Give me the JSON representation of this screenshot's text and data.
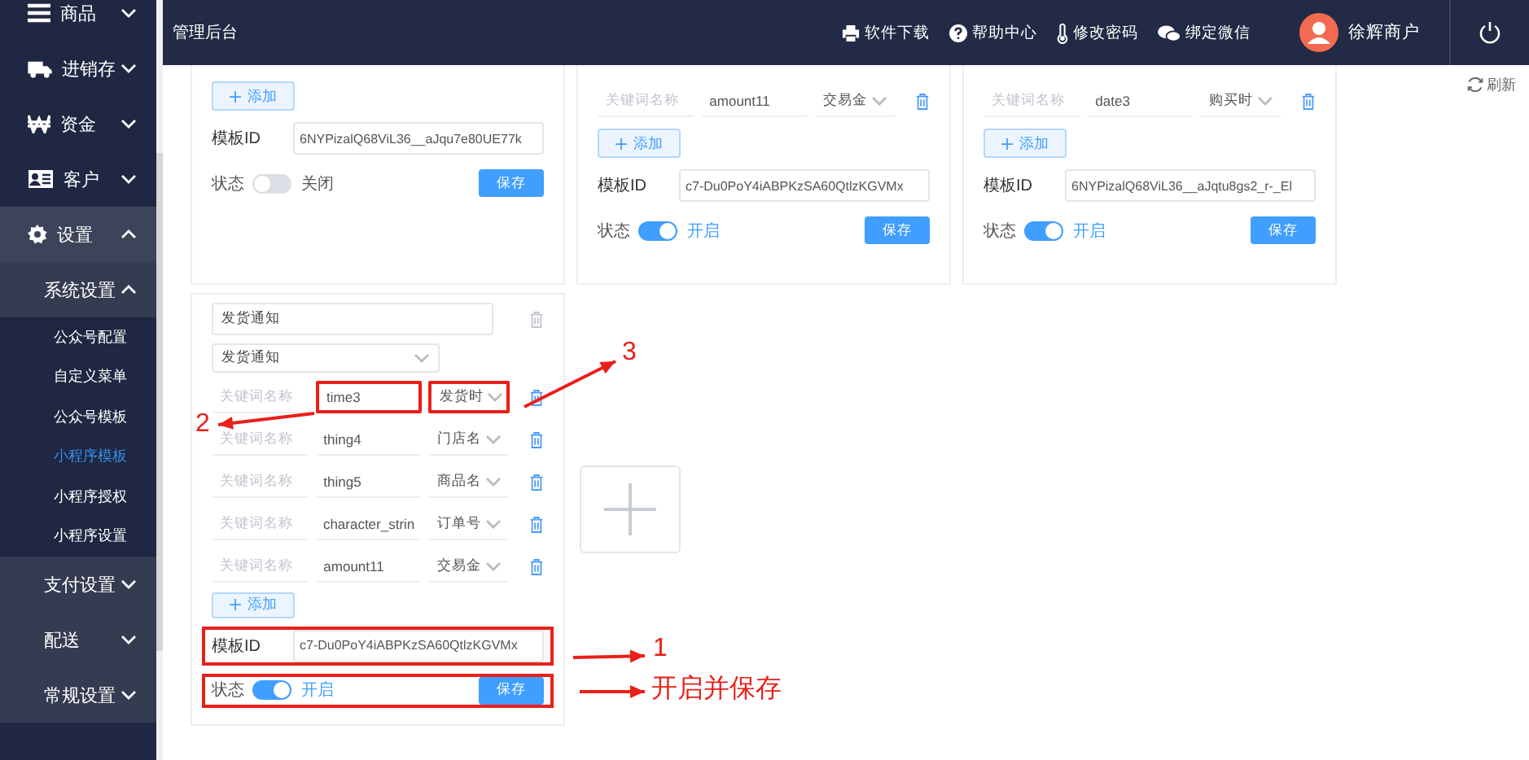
{
  "header": {
    "title": "管理后台",
    "links": [
      {
        "label": "软件下载"
      },
      {
        "label": "帮助中心"
      },
      {
        "label": "修改密码"
      },
      {
        "label": "绑定微信"
      }
    ],
    "user": "徐辉商户"
  },
  "sidebar": {
    "items": [
      {
        "label": "商品",
        "expanded": false
      },
      {
        "label": "进销存",
        "expanded": false
      },
      {
        "label": "资金",
        "expanded": false
      },
      {
        "label": "客户",
        "expanded": false
      },
      {
        "label": "设置",
        "expanded": true,
        "children": [
          {
            "label": "系统设置",
            "expanded": true,
            "children": [
              {
                "label": "公众号配置",
                "selected": false
              },
              {
                "label": "自定义菜单",
                "selected": false
              },
              {
                "label": "公众号模板",
                "selected": false
              },
              {
                "label": "小程序模板",
                "selected": true
              },
              {
                "label": "小程序授权",
                "selected": false
              },
              {
                "label": "小程序设置",
                "selected": false
              }
            ]
          },
          {
            "label": "支付设置",
            "expanded": false
          },
          {
            "label": "配送",
            "expanded": false
          },
          {
            "label": "常规设置",
            "expanded": false
          }
        ]
      }
    ]
  },
  "refresh": "刷新",
  "templates": [
    {
      "add": "添加",
      "id_label": "模板ID",
      "template_id": "6NYPizalQ68ViL36__aJqu7e80UE77k",
      "status_label": "状态",
      "on": false,
      "status_text": "关闭",
      "save": "保存"
    },
    {
      "keywords": [
        {
          "placeholder": "关键词名称",
          "value": "amount11",
          "type": "交易金",
          "value_highlighted": false,
          "type_highlighted": false
        }
      ],
      "add": "添加",
      "id_label": "模板ID",
      "template_id": "c7-Du0PoY4iABPKzSA60QtlzKGVMx",
      "status_label": "状态",
      "on": true,
      "status_text": "开启",
      "save": "保存"
    },
    {
      "keywords": [
        {
          "placeholder": "关键词名称",
          "value": "date3",
          "type": "购买时",
          "value_highlighted": false,
          "type_highlighted": false
        }
      ],
      "add": "添加",
      "id_label": "模板ID",
      "template_id": "6NYPizalQ68ViL36__aJqtu8gs2_r-_El",
      "status_label": "状态",
      "on": true,
      "status_text": "开启",
      "save": "保存"
    },
    {
      "title": "发货通知",
      "template_name": "发货通知",
      "keywords": [
        {
          "placeholder": "关键词名称",
          "value": "time3",
          "type": "发货时",
          "value_highlighted": true,
          "type_highlighted": true
        },
        {
          "placeholder": "关键词名称",
          "value": "thing4",
          "type": "门店名",
          "value_highlighted": false,
          "type_highlighted": false
        },
        {
          "placeholder": "关键词名称",
          "value": "thing5",
          "type": "商品名",
          "value_highlighted": false,
          "type_highlighted": false
        },
        {
          "placeholder": "关键词名称",
          "value": "character_strin",
          "type": "订单号",
          "value_highlighted": false,
          "type_highlighted": false
        },
        {
          "placeholder": "关键词名称",
          "value": "amount11",
          "type": "交易金",
          "value_highlighted": false,
          "type_highlighted": false
        }
      ],
      "add": "添加",
      "id_label": "模板ID",
      "template_id": "c7-Du0PoY4iABPKzSA60QtlzKGVMx",
      "id_highlighted": true,
      "status_label": "状态",
      "on": true,
      "status_text": "开启",
      "status_highlighted": true,
      "save": "保存"
    }
  ],
  "annotations": [
    {
      "label": "1"
    },
    {
      "label": "2"
    },
    {
      "label": "3"
    },
    {
      "label": "开启并保存"
    }
  ]
}
